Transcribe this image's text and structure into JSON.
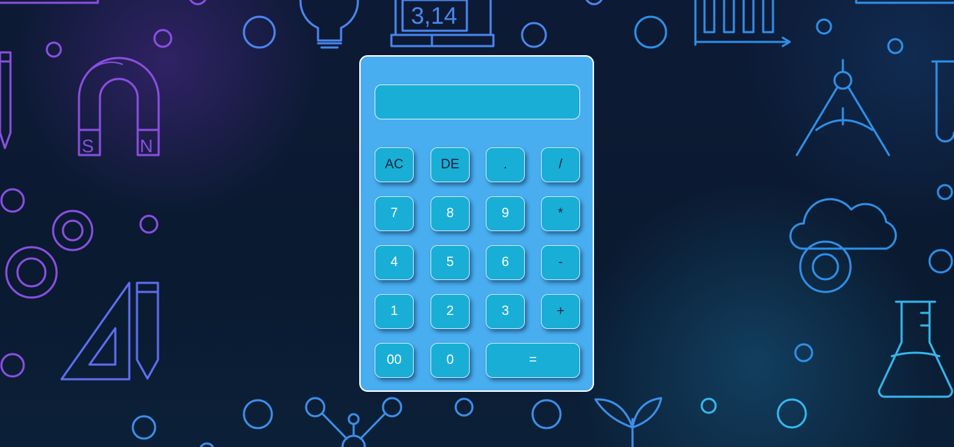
{
  "calculator": {
    "display": {
      "value": "",
      "placeholder": ""
    },
    "keys": {
      "ac": "AC",
      "de": "DE",
      "dot": ".",
      "divide": "/",
      "seven": "7",
      "eight": "8",
      "nine": "9",
      "multiply": "*",
      "four": "4",
      "five": "5",
      "six": "6",
      "minus": "-",
      "one": "1",
      "two": "2",
      "three": "3",
      "plus": "+",
      "double_zero": "00",
      "zero": "0",
      "equals": "="
    }
  },
  "background": {
    "decor_text": {
      "pi_screen": "3,14",
      "magnet_s": "S",
      "magnet_n": "N"
    },
    "colors": {
      "purple": "#7c4fd8",
      "blue": "#2f8fe0",
      "cyan": "#3ab4ea"
    }
  }
}
